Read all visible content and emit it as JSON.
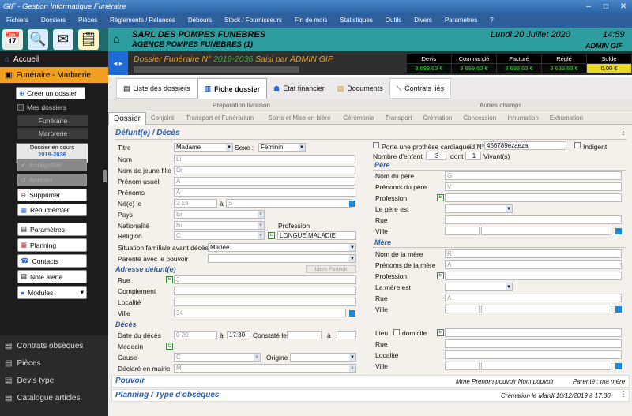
{
  "window": {
    "title": "GIF - Gestion Informatique Funéraire",
    "minimize": "–",
    "maximize": "□",
    "close": "✕"
  },
  "menu": [
    "Fichiers",
    "Dossiers",
    "Pièces",
    "Règlements / Relances",
    "Débours",
    "Stock / Fournisseurs",
    "Fin de mois",
    "Statistiques",
    "Outils",
    "Divers",
    "Paramètres",
    "?"
  ],
  "toolbar": [
    "calendar-icon",
    "search-icon",
    "mail-icon",
    "notes-icon"
  ],
  "header": {
    "company": "SARL DES POMPES FUNEBRES",
    "agency": "AGENCE POMPES FUNEBRES (1)",
    "date": "Lundi 20 Juillet 2020",
    "time": "14:59",
    "user": "ADMIN GIF"
  },
  "dossier": {
    "prefix": "Dossier Funéraire N°",
    "number": "2019-2036",
    "suffix": "Saisi par",
    "user": "ADMIN GIF"
  },
  "totals": {
    "headers": [
      "Devis",
      "Commandé",
      "Facturé",
      "Réglé",
      "Solde"
    ],
    "values": [
      "3 699,63 €",
      "3 699,63 €",
      "3 699,63 €",
      "3 699,63 €",
      "0,00 €"
    ]
  },
  "nav": {
    "accueil": "Accueil",
    "funeraire": "Funéraire - Marbrerie",
    "creer": "Créer un dossier",
    "mes": "Mes dossiers",
    "funeraire2": "Funéraire",
    "marbrerie": "Marbrerie",
    "encours": "Dossier en cours",
    "encours_num": "2019-2036",
    "enregistrer": "Enregistrer",
    "annuler": "Annuler",
    "supprimer": "Supprimer",
    "renumeroter": "Renuméroter",
    "parametres": "Paramètres",
    "planning": "Planning",
    "contacts": "Contacts",
    "note": "Note alerte",
    "modules": "Modules"
  },
  "bottomnav": [
    "Contrats obsèques",
    "Pièces",
    "Devis type",
    "Catalogue articles"
  ],
  "tabs1": [
    "Liste des dossiers",
    "Fiche dossier",
    "Etat financier",
    "Documents",
    "Contrats liés"
  ],
  "groups": {
    "prep": "Préparation livraison",
    "autres": "Autres champs"
  },
  "tabs2": [
    "Dossier",
    "Conjoint",
    "Transport et Funérarium",
    "Soins et Mise en bière",
    "Cérémonie",
    "Transport",
    "Crémation",
    "Concession",
    "Inhumation",
    "Exhumation"
  ],
  "sections": {
    "defunt": "Défunt(e) / Décès",
    "adresse": "Adresse défunt(e)",
    "deces": "Décès",
    "pere": "Père",
    "mere": "Mère",
    "pouvoir": "Pouvoir",
    "planning": "Planning / Type d'obsèques"
  },
  "labels": {
    "titre": "Titre",
    "sexe": "Sexe :",
    "nom": "Nom",
    "nom_jf": "Nom de jeune fille",
    "prenom_usuel": "Prénom usuel",
    "prenoms": "Prénoms",
    "ne": "Né(e) le",
    "a": "à",
    "pays": "Pays",
    "nationalite": "Nationalité",
    "religion": "Religion",
    "profession": "Profession",
    "situation": "Situation familiale avant décès",
    "parente": "Parenté avec le pouvoir",
    "rue": "Rue",
    "complement": "Complement",
    "localite": "Localité",
    "ville": "Ville",
    "date_deces": "Date du décès",
    "constate": "Constaté le",
    "medecin": "Medecin",
    "cause": "Cause",
    "origine": "Origine",
    "declare": "Déclaré en mairie",
    "prothese": "Porte une prothèse cardiaque",
    "id": "Id N°",
    "indigent": "Indigent",
    "nb_enfant": "Nombre d'enfant",
    "dont": "dont",
    "vivants": "Vivant(s)",
    "nom_pere": "Nom du père",
    "prenoms_pere": "Prénoms du père",
    "pere_est": "Le père est",
    "nom_mere": "Nom de la mère",
    "prenoms_mere": "Prénoms de la mère",
    "mere_est": "La mère est",
    "lieu": "Lieu",
    "domicile": "domicile",
    "idem": "Idem Pouvoir"
  },
  "values": {
    "titre": "Madame",
    "sexe": "Féminin",
    "nom": "Li",
    "nom_jf": "Dr",
    "prenom_usuel": "A",
    "prenoms": "A",
    "ne_date": "2 19",
    "ne_lieu": "S",
    "pays": "Bi",
    "nationalite": "Bi",
    "religion": "C",
    "profession": "LONGUE MALADIE",
    "situation": "Mariée",
    "adresse_rue": "3",
    "adresse_ville": "34",
    "deces_date": "0 20",
    "deces_heure": "17:30",
    "cause": "C",
    "declare": "M",
    "id": "456789ezaeza",
    "nb_enfant": "3",
    "vivants": "1",
    "nom_pere": "G",
    "prenoms_pere": "V",
    "nom_mere": "R",
    "prenoms_mere": "A",
    "mere_rue": "A"
  },
  "footer": {
    "pouvoir": "Mme Prenom pouvoir Nom pouvoir",
    "parente": "Parenté : ma mère",
    "creation": "Crémation le Mardi 10/12/2019 à 17:30"
  }
}
